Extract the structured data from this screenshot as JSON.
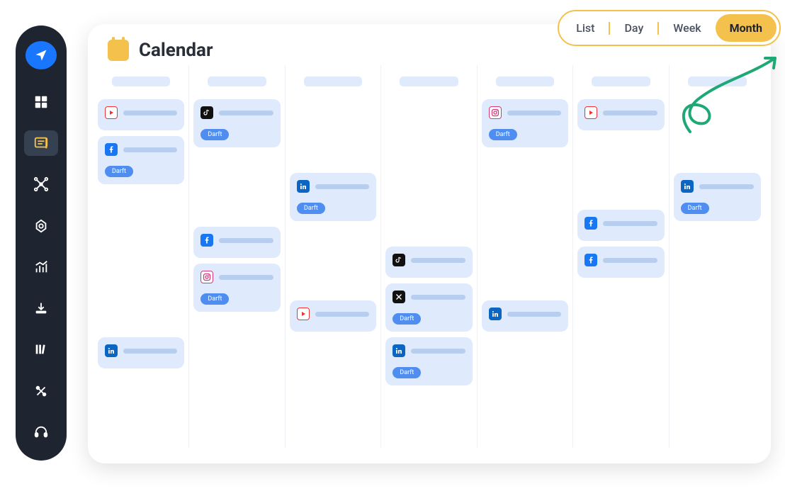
{
  "app": {
    "title": "Calendar"
  },
  "views": {
    "list": "List",
    "day": "Day",
    "week": "Week",
    "month": "Month",
    "active": "month"
  },
  "badge": {
    "draft": "Darft"
  },
  "sidebar": {
    "items": [
      {
        "name": "logo",
        "icon": "send"
      },
      {
        "name": "dashboard",
        "icon": "grid"
      },
      {
        "name": "messages",
        "icon": "chat",
        "active": true
      },
      {
        "name": "network",
        "icon": "nodes"
      },
      {
        "name": "target",
        "icon": "target"
      },
      {
        "name": "analytics",
        "icon": "chart"
      },
      {
        "name": "download",
        "icon": "download"
      },
      {
        "name": "library",
        "icon": "books"
      },
      {
        "name": "tools",
        "icon": "wrench"
      },
      {
        "name": "support",
        "icon": "headset"
      }
    ]
  },
  "columns": [
    {
      "cards": [
        {
          "platform": "youtube",
          "draft": false
        },
        {
          "platform": "facebook",
          "draft": true
        },
        {
          "platform": "spacer"
        },
        {
          "platform": "spacer"
        },
        {
          "platform": "linkedin",
          "draft": false
        }
      ]
    },
    {
      "cards": [
        {
          "platform": "tiktok",
          "draft": true
        },
        {
          "platform": "spacer"
        },
        {
          "platform": "facebook",
          "draft": false
        },
        {
          "platform": "instagram",
          "draft": true
        }
      ]
    },
    {
      "cards": [
        {
          "platform": "spacer"
        },
        {
          "platform": "linkedin",
          "draft": true
        },
        {
          "platform": "spacer"
        },
        {
          "platform": "youtube",
          "draft": false
        }
      ]
    },
    {
      "cards": [
        {
          "platform": "spacer"
        },
        {
          "platform": "spacer"
        },
        {
          "platform": "tiktok",
          "draft": false
        },
        {
          "platform": "x",
          "draft": true
        },
        {
          "platform": "linkedin",
          "draft": true
        }
      ]
    },
    {
      "cards": [
        {
          "platform": "instagram",
          "draft": true
        },
        {
          "platform": "spacer"
        },
        {
          "platform": "spacer"
        },
        {
          "platform": "linkedin",
          "draft": false
        }
      ]
    },
    {
      "cards": [
        {
          "platform": "youtube",
          "draft": false
        },
        {
          "platform": "spacer"
        },
        {
          "platform": "facebook",
          "draft": false
        },
        {
          "platform": "facebook",
          "draft": false
        }
      ]
    },
    {
      "cards": [
        {
          "platform": "spacer"
        },
        {
          "platform": "linkedin",
          "draft": true
        }
      ]
    }
  ]
}
